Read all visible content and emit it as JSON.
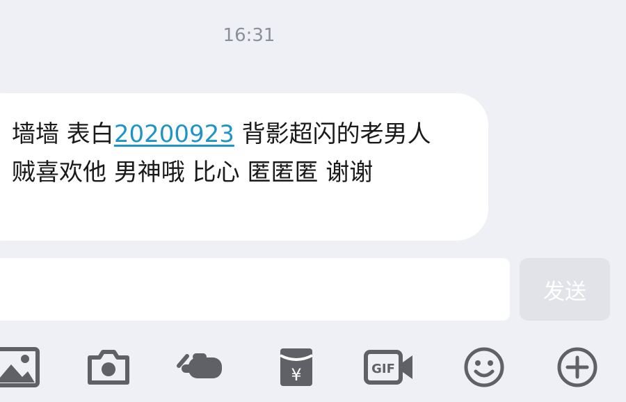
{
  "timestamp": "16:31",
  "message": {
    "prefix": "墙墙  表白",
    "link_text": "20200923",
    "suffix": " 背影超闪的老男人 贼喜欢他 男神哦 比心 匿匿匿 谢谢"
  },
  "input": {
    "placeholder": "",
    "value": ""
  },
  "send_label": "发送",
  "toolbar": {
    "icons": [
      "image-icon",
      "camera-icon",
      "poke-icon",
      "red-packet-icon",
      "gif-icon",
      "emoji-icon",
      "plus-icon"
    ],
    "red_packet_symbol": "¥",
    "gif_label": "GIF"
  },
  "colors": {
    "background": "#eef0f5",
    "bubble": "#ffffff",
    "link": "#1f94c8",
    "icon": "#5f6166",
    "send_button": "#e1e3e8"
  }
}
